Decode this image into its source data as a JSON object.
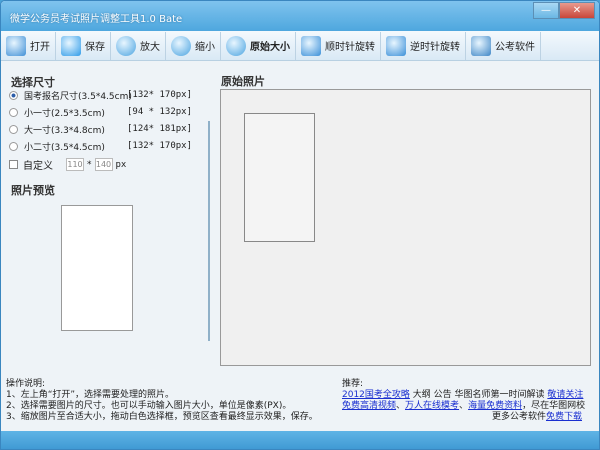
{
  "window": {
    "title": "微学公务员考试照片调整工具1.0 Bate",
    "minimize": "—",
    "close": "✕"
  },
  "toolbar": [
    {
      "label": "打开",
      "icon": "open-icon",
      "color": "#3f8fd6"
    },
    {
      "label": "保存",
      "icon": "save-icon",
      "color": "#2f9be8"
    },
    {
      "label": "放大",
      "icon": "zoom-in-icon",
      "color": "#4aa3e0"
    },
    {
      "label": "缩小",
      "icon": "zoom-out-icon",
      "color": "#4aa3e0"
    },
    {
      "label": "原始大小",
      "icon": "magnifier-icon",
      "color": "#4aa3e0"
    },
    {
      "label": "顺时针旋转",
      "icon": "rotate-cw-icon",
      "color": "#3a8fd8"
    },
    {
      "label": "逆时针旋转",
      "icon": "rotate-ccw-icon",
      "color": "#3a8fd8"
    },
    {
      "label": "公考软件",
      "icon": "download-globe-icon",
      "color": "#3e86c6"
    }
  ],
  "size": {
    "heading": "选择尺寸",
    "options": [
      {
        "label": "国考报名尺寸(3.5*4.5cm)",
        "px": "[132* 170px]",
        "selected": true
      },
      {
        "label": "小一寸(2.5*3.5cm)",
        "px": "[94 * 132px]",
        "selected": false
      },
      {
        "label": "大一寸(3.3*4.8cm)",
        "px": "[124* 181px]",
        "selected": false
      },
      {
        "label": "小二寸(3.5*4.5cm)",
        "px": "[132* 170px]",
        "selected": false
      }
    ],
    "custom": {
      "label": "自定义",
      "checked": false,
      "width": "110",
      "sep": "*",
      "height": "140",
      "unit": "px"
    }
  },
  "preview": {
    "heading": "照片预览"
  },
  "original": {
    "heading": "原始照片"
  },
  "help": {
    "title": "操作说明:",
    "lines": [
      "1、左上角“打开”，选择需要处理的照片。",
      "2、选择需要图片的尺寸。也可以手动输入图片大小，单位是像素(PX)。",
      "3、缩放图片至合适大小，拖动白色选择框，预览区查看最终显示效果，保存。"
    ]
  },
  "recommend": {
    "title": "推荐:",
    "link1": "2012国考全攻略",
    "text1": " 大纲 公告 华图名师第一时间解读 ",
    "link2": "敬请关注",
    "link3": "免费高清视频",
    "sep1": "、",
    "link4": "万人在线模考",
    "sep2": "、",
    "link5": "海量免费资料",
    "text2": "，尽在华图网校",
    "text3": "更多公考软件",
    "link6": "免费下载"
  }
}
